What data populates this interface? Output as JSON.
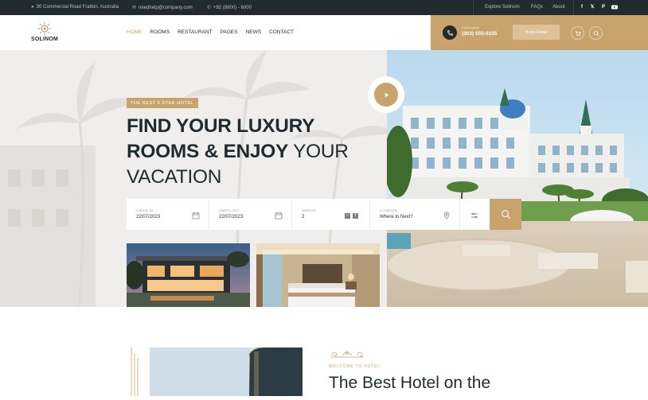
{
  "topbar": {
    "address": "30 Commercial Road Fratton, Australia",
    "email": "needhelp@company.com",
    "phone": "+92 (8800) - 6000",
    "links": [
      "Explore Solinom",
      "FAQs",
      "About"
    ]
  },
  "header": {
    "logo_text": "SOLINOM",
    "nav": [
      "HOME",
      "ROOMS",
      "RESTAURANT",
      "PAGES",
      "NEWS",
      "CONTACT"
    ],
    "active_nav": "HOME",
    "call_label": "Call Anytime",
    "call_number": "(303) 555-0105",
    "book_button": "Book Hotel"
  },
  "hero": {
    "badge": "THE BEST 5 STAR HOTEL",
    "headline_line1": "FIND YOUR LUXURY",
    "headline_line2_bold": "ROOMS & ENJOY",
    "headline_line2_thin": " YOUR",
    "headline_line3": "VACATION"
  },
  "search": {
    "checkin_label": "CHECK-IN",
    "checkin_value": "22/07/2023",
    "checkout_label": "CHECK-OUT",
    "checkout_value": "22/07/2023",
    "guests_label": "GUESTS",
    "guests_value": "2",
    "location_label": "LOCATION",
    "location_value": "Where to Next?"
  },
  "about": {
    "eyebrow": "WELCOME TO HOTEL",
    "title": "The Best Hotel on the"
  },
  "colors": {
    "accent": "#c8a46c",
    "dark": "#1f2b2f",
    "topbar_bg": "#1f2b2f"
  }
}
